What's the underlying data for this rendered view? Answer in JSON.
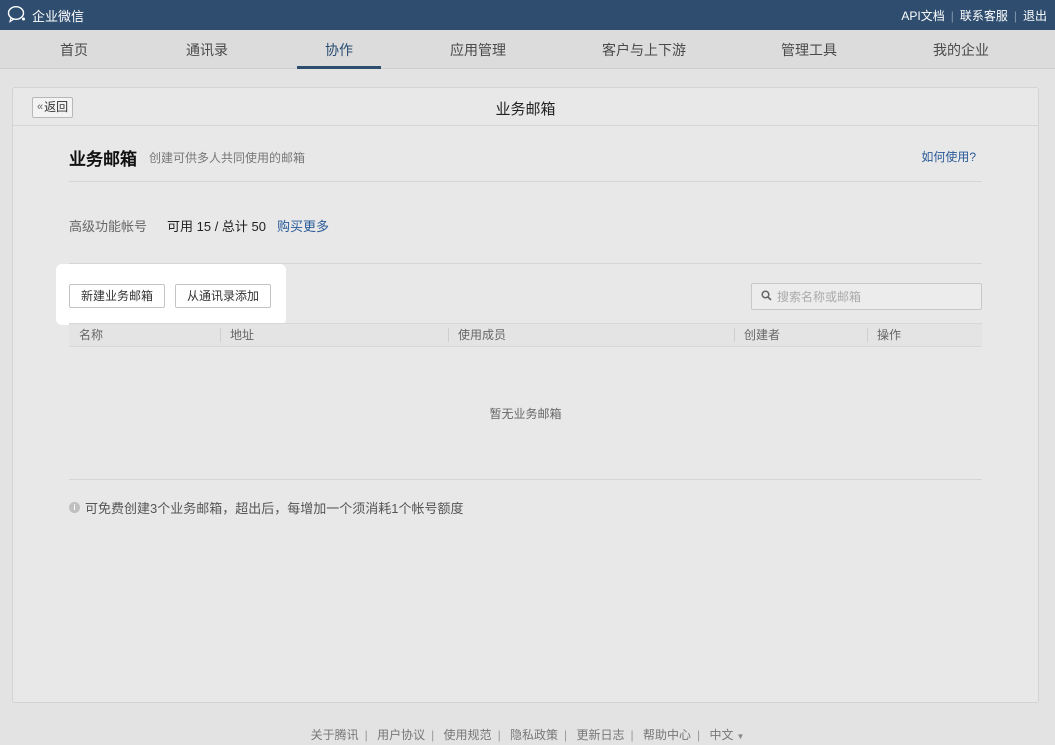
{
  "app": {
    "brand": "企业微信"
  },
  "top_links": [
    "API文档",
    "联系客服",
    "退出"
  ],
  "nav": {
    "items": [
      {
        "label": "首页",
        "active": false
      },
      {
        "label": "通讯录",
        "active": false
      },
      {
        "label": "协作",
        "active": true
      },
      {
        "label": "应用管理",
        "active": false
      },
      {
        "label": "客户与上下游",
        "active": false
      },
      {
        "label": "管理工具",
        "active": false
      },
      {
        "label": "我的企业",
        "active": false
      }
    ]
  },
  "page": {
    "back_label": "返回",
    "title": "业务邮箱",
    "section_title": "业务邮箱",
    "section_subtitle": "创建可供多人共同使用的邮箱",
    "help_link": "如何使用?",
    "quota_label": "高级功能帐号",
    "quota_value": "可用 15 / 总计 50",
    "buy_more": "购买更多",
    "new_button": "新建业务邮箱",
    "import_button": "从通讯录添加",
    "search_placeholder": "搜索名称或邮箱",
    "columns": [
      "名称",
      "地址",
      "使用成员",
      "创建者",
      "操作"
    ],
    "empty_text": "暂无业务邮箱",
    "note": "可免费创建3个业务邮箱，超出后，每增加一个须消耗1个帐号额度"
  },
  "footer": {
    "links": [
      "关于腾讯",
      "用户协议",
      "使用规范",
      "隐私政策",
      "更新日志",
      "帮助中心",
      "中文"
    ]
  },
  "colors": {
    "topbar": "#2f4e6f",
    "link": "#2a5a99",
    "active_tab": "#2f4e6f"
  }
}
